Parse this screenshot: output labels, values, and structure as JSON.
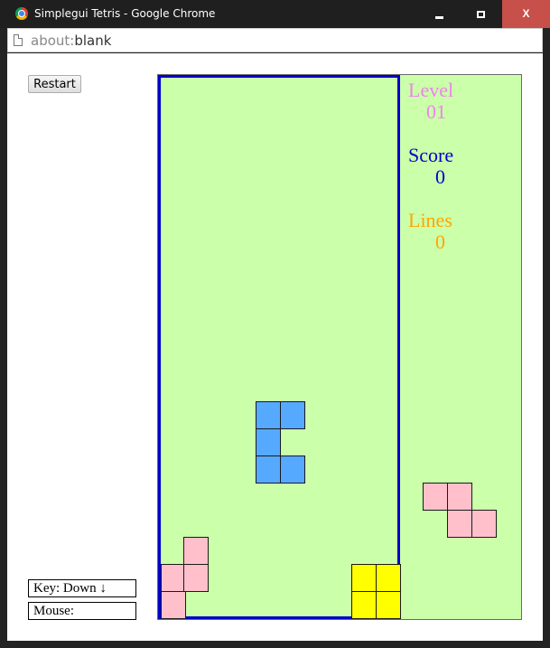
{
  "window": {
    "title": "Simplegui Tetris - Google Chrome",
    "controls": {
      "minimize": "minimize",
      "maximize": "maximize",
      "close": "X"
    }
  },
  "address": {
    "scheme": "about:",
    "path": "blank"
  },
  "page": {
    "restart_label": "Restart",
    "key_status": "Key: Down ↓",
    "mouse_status": "Mouse:"
  },
  "game": {
    "level_label": "Level",
    "level_value": "01",
    "score_label": "Score",
    "score_value": "0",
    "lines_label": "Lines",
    "lines_value": "0",
    "colors": {
      "background": "#ccffaa",
      "well_border": "#0000cc",
      "blue_piece": "#55aaff",
      "pink_piece": "#ffc0cb",
      "yellow_piece": "#ffff00",
      "level_text": "#ee82ee",
      "score_text": "#0000cc",
      "lines_text": "#ffa500"
    }
  }
}
